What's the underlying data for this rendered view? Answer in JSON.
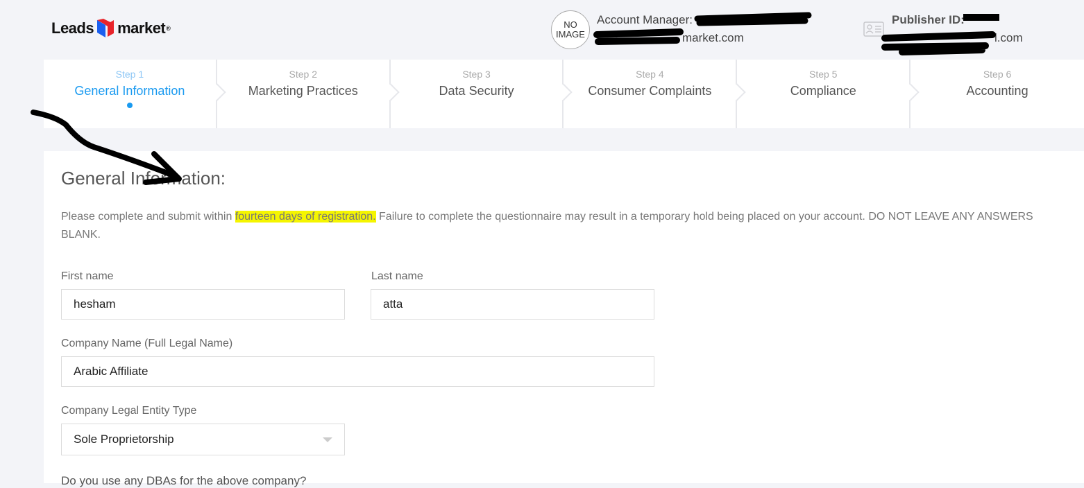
{
  "header": {
    "logo": {
      "left": "Leads",
      "right": "market",
      "reg": "®",
      "colors": {
        "red": "#e8232a",
        "blue": "#1a5ff0"
      }
    },
    "avatar": {
      "line1": "NO",
      "line2": "IMAGE"
    },
    "account_manager_label": "Account Manager:",
    "account_manager_email_visible": "market.com",
    "publisher_id_label": "Publisher ID:",
    "publisher_email_visible": "l.com",
    "id_card_icon": "id-card-icon"
  },
  "steps": [
    {
      "num": "Step 1",
      "label": "General Information",
      "active": true
    },
    {
      "num": "Step 2",
      "label": "Marketing Practices"
    },
    {
      "num": "Step 3",
      "label": "Data Security"
    },
    {
      "num": "Step 4",
      "label": "Consumer Complaints"
    },
    {
      "num": "Step 5",
      "label": "Compliance"
    },
    {
      "num": "Step 6",
      "label": "Accounting"
    }
  ],
  "form": {
    "title": "General Information:",
    "intro_before": "Please complete and submit within ",
    "intro_highlight": "fourteen days of registration.",
    "intro_after": " Failure to complete the questionnaire may result in a temporary hold being placed on your account. DO NOT LEAVE ANY ANSWERS BLANK.",
    "first_name_label": "First name",
    "first_name_value": "hesham",
    "last_name_label": "Last name",
    "last_name_value": "atta",
    "company_label": "Company Name (Full Legal Name)",
    "company_value": "Arabic Affiliate",
    "entity_label": "Company Legal Entity Type",
    "entity_value": "Sole Proprietorship",
    "dba_label": "Do you use any DBAs for the above company?"
  },
  "colors": {
    "accent": "#1a9af0",
    "highlight": "#f5f500"
  }
}
